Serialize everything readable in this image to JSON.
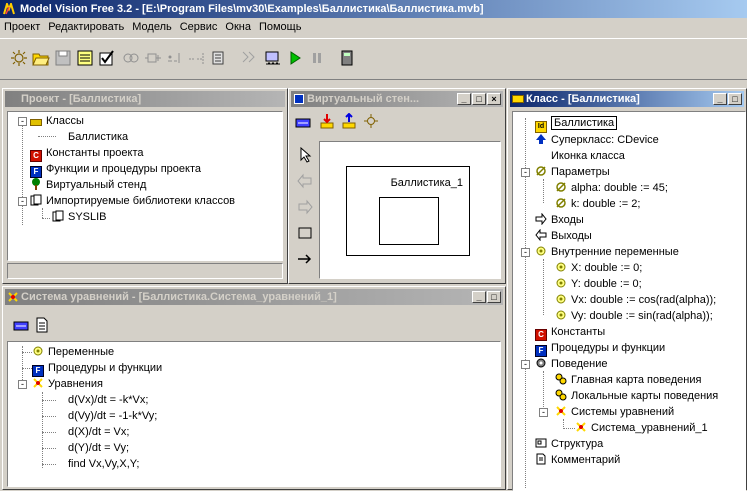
{
  "app": {
    "title": "Model Vision Free 3.2 - [E:\\Program Files\\mv30\\Examples\\Баллистика\\Баллистика.mvb]"
  },
  "menu": [
    "Проект",
    "Редактировать",
    "Модель",
    "Сервис",
    "Окна",
    "Помощь"
  ],
  "project_window": {
    "title": "Проект - [Баллистика]",
    "items": [
      "Классы",
      "Баллистика",
      "Константы проекта",
      "Функции и процедуры проекта",
      "Виртуальный стенд",
      "Импортируемые библиотеки классов",
      "SYSLIB"
    ]
  },
  "stand_window": {
    "title": "Виртуальный стен...",
    "block_label": "Баллистика_1"
  },
  "equations_window": {
    "title": "Система уравнений - [Баллистика.Система_уравнений_1]",
    "items": [
      "Переменные",
      "Процедуры и функции",
      "Уравнения"
    ],
    "equations": [
      "d(Vx)/dt = -k*Vx;",
      "d(Vy)/dt = -1-k*Vy;",
      "d(X)/dt = Vx;",
      "d(Y)/dt = Vy;",
      "find Vx,Vy,X,Y;"
    ]
  },
  "class_window": {
    "title": "Класс - [Баллистика]",
    "items": [
      "Баллистика",
      "Суперкласс: CDevice",
      "Иконка класса",
      "Параметры",
      "alpha: double := 45;",
      "k: double := 2;",
      "Входы",
      "Выходы",
      "Внутренние переменные",
      "X: double := 0;",
      "Y: double := 0;",
      "Vx: double := cos(rad(alpha));",
      "Vy: double := sin(rad(alpha));",
      "Константы",
      "Процедуры и функции",
      "Поведение",
      "Главная карта поведения",
      "Локальные карты поведения",
      "Системы уравнений",
      "Система_уравнений_1",
      "Структура",
      "Комментарий"
    ]
  },
  "colors": {
    "active_title": "#0a246a",
    "inactive_title": "#808080",
    "face": "#d4d0c8"
  }
}
